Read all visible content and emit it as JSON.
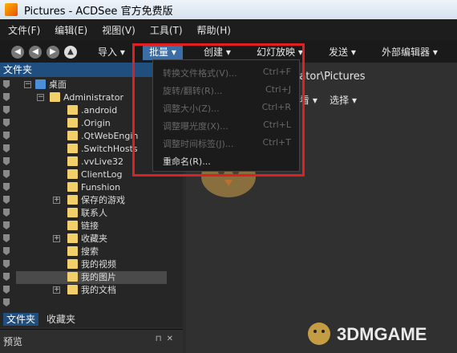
{
  "window": {
    "title": "Pictures - ACDSee 官方免费版"
  },
  "menubar": {
    "items": [
      "文件(F)",
      "编辑(E)",
      "视图(V)",
      "工具(T)",
      "帮助(H)"
    ]
  },
  "toolbar": {
    "import": "导入",
    "batch": "批量",
    "create": "创建",
    "slideshow": "幻灯放映",
    "send": "发送",
    "external_editor": "外部编辑器",
    "dropdown_arrow": "▾"
  },
  "left_pane": {
    "title": "文件夹",
    "tree": [
      {
        "label": "桌面"
      },
      {
        "label": "Administrator"
      },
      {
        "label": ".android"
      },
      {
        "label": ".Origin"
      },
      {
        "label": ".QtWebEngin"
      },
      {
        "label": ".SwitchHosts"
      },
      {
        "label": ".vvLive32"
      },
      {
        "label": "ClientLog"
      },
      {
        "label": "Funshion"
      },
      {
        "label": "保存的游戏"
      },
      {
        "label": "联系人"
      },
      {
        "label": "链接"
      },
      {
        "label": "收藏夹"
      },
      {
        "label": "搜索"
      },
      {
        "label": "我的视频"
      },
      {
        "label": "我的图片"
      },
      {
        "label": "我的文档"
      }
    ],
    "tabs": [
      "文件夹",
      "收藏夹"
    ]
  },
  "preview": {
    "label": "预览"
  },
  "main": {
    "path": "rator\\Pictures",
    "view_bar": {
      "view": "查看",
      "select": "选择"
    }
  },
  "batch_menu": {
    "items": [
      {
        "label": "转换文件格式(V)...",
        "shortcut": "Ctrl+F",
        "enabled": false
      },
      {
        "label": "旋转/翻转(R)...",
        "shortcut": "Ctrl+J",
        "enabled": false
      },
      {
        "label": "调整大小(Z)...",
        "shortcut": "Ctrl+R",
        "enabled": false
      },
      {
        "label": "调整曝光度(X)...",
        "shortcut": "Ctrl+L",
        "enabled": false
      },
      {
        "label": "调整时间标签(J)...",
        "shortcut": "Ctrl+T",
        "enabled": false
      },
      {
        "label": "重命名(R)...",
        "shortcut": "",
        "enabled": true
      }
    ]
  },
  "watermark": {
    "text": "3DMGAME"
  },
  "colors": {
    "highlight_box": "#e02020",
    "selection": "#3a6ea5",
    "pane_header": "#1f4e7f"
  }
}
